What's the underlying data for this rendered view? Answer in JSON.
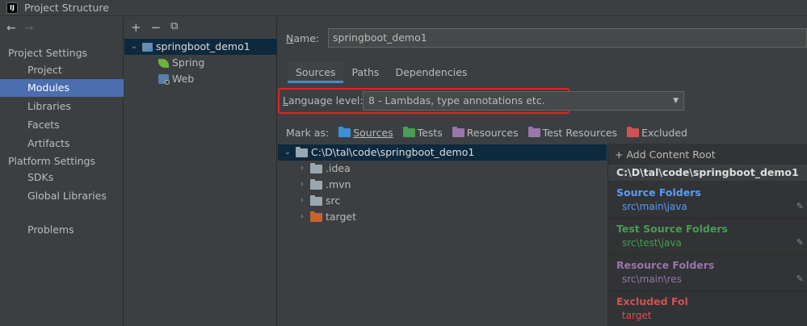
{
  "window": {
    "title": "Project Structure",
    "app_icon": "IJ"
  },
  "sidebar": {
    "back_arrow": "←",
    "forward_arrow": "→",
    "project_settings_header": "Project Settings",
    "project_items": [
      "Project",
      "Modules",
      "Libraries",
      "Facets",
      "Artifacts"
    ],
    "platform_settings_header": "Platform Settings",
    "platform_items": [
      "SDKs",
      "Global Libraries"
    ],
    "problems": "Problems",
    "selected": "Modules"
  },
  "modules": {
    "toolbar": {
      "add": "+",
      "remove": "−",
      "copy": "⧉"
    },
    "root": "springboot_demo1",
    "children": [
      "Spring",
      "Web"
    ]
  },
  "main": {
    "name_label_prefix": "N",
    "name_label_rest": "ame:",
    "name_value": "springboot_demo1",
    "tabs": [
      "Sources",
      "Paths",
      "Dependencies"
    ],
    "active_tab": "Sources",
    "language_label_prefix": "L",
    "language_label_rest": "anguage level:",
    "language_value": "8 - Lambdas, type annotations etc.",
    "mark_as": "Mark as:",
    "mark_buttons": [
      {
        "label": "Sources",
        "color": "#3d8fd6"
      },
      {
        "label": "Tests",
        "color": "#499c54"
      },
      {
        "label": "Resources",
        "color": "#9876aa"
      },
      {
        "label": "Test Resources",
        "color": "#9876aa"
      },
      {
        "label": "Excluded",
        "color": "#d25252"
      }
    ]
  },
  "content_tree": {
    "root": "C:\\D\\tal\\code\\springboot_demo1",
    "children": [
      {
        "label": ".idea",
        "color": "#9aa7b0"
      },
      {
        "label": ".mvn",
        "color": "#9aa7b0"
      },
      {
        "label": "src",
        "color": "#9aa7b0"
      },
      {
        "label": "target",
        "color": "#c5632f"
      }
    ]
  },
  "roots_panel": {
    "add_content_root": "+ Add Content Root",
    "path": "C:\\D\\tal\\code\\springboot_demo1",
    "groups": [
      {
        "title": "Source Folders",
        "path": "src\\main\\java",
        "color": "#589df6"
      },
      {
        "title": "Test Source Folders",
        "path": "src\\test\\java",
        "color": "#499c54"
      },
      {
        "title": "Resource Folders",
        "path": "src\\main\\res",
        "color": "#9876aa"
      },
      {
        "title": "Excluded Fol",
        "path": "target",
        "color": "#d25252"
      }
    ]
  },
  "colors": {
    "selection": "#4b6eaf",
    "highlight_box": "#e02424",
    "tab_underline": "#4a88c7"
  }
}
